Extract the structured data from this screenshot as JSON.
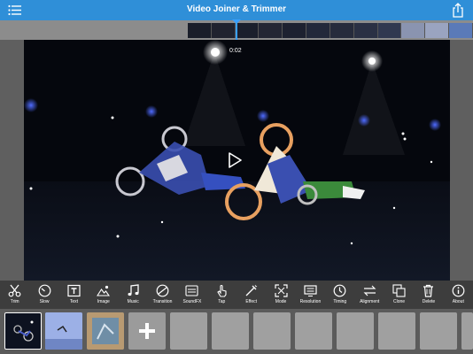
{
  "app": {
    "title": "Video Joiner & Trimmer"
  },
  "navbar": {
    "menu_icon": "hamburger-icon",
    "share_icon": "share-icon"
  },
  "player": {
    "current_time": "0:02",
    "play_icon": "play-icon"
  },
  "toolbar": {
    "items": [
      {
        "label": "Trim",
        "icon": "scissors-icon"
      },
      {
        "label": "Slow",
        "icon": "speedometer-icon"
      },
      {
        "label": "Text",
        "icon": "text-icon"
      },
      {
        "label": "Image",
        "icon": "image-icon"
      },
      {
        "label": "Music",
        "icon": "music-icon"
      },
      {
        "label": "Transition",
        "icon": "transition-icon"
      },
      {
        "label": "SoundFX",
        "icon": "soundfx-icon"
      },
      {
        "label": "Tap",
        "icon": "tap-icon"
      },
      {
        "label": "Effect",
        "icon": "effect-icon"
      },
      {
        "label": "Mode",
        "icon": "mode-icon"
      },
      {
        "label": "Resolution",
        "icon": "resolution-icon"
      },
      {
        "label": "Timing",
        "icon": "timing-icon"
      },
      {
        "label": "Alignment",
        "icon": "alignment-icon"
      },
      {
        "label": "Clone",
        "icon": "clone-icon"
      },
      {
        "label": "Delete",
        "icon": "trash-icon"
      },
      {
        "label": "About",
        "icon": "info-icon"
      }
    ]
  },
  "clips": {
    "add_icon": "plus-icon"
  },
  "colors": {
    "nav": "#2f8fd8",
    "toolbar": "#3d3d3d",
    "accent": "#39a0ff"
  }
}
